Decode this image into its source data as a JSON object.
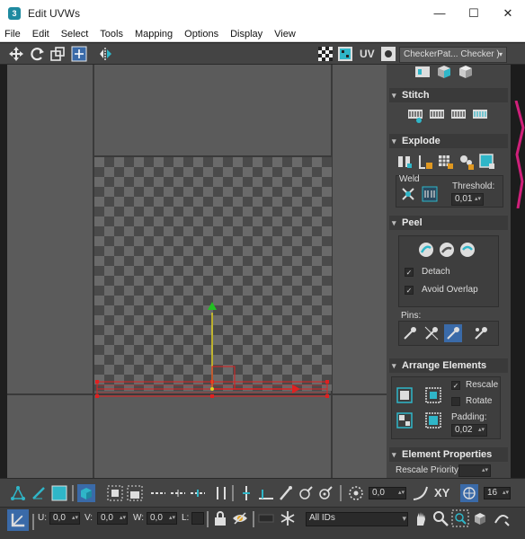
{
  "window": {
    "title": "Edit UVWs",
    "app_icon": "3"
  },
  "menu": [
    "File",
    "Edit",
    "Select",
    "Tools",
    "Mapping",
    "Options",
    "Display",
    "View"
  ],
  "toolbar_top": {
    "uv_label": "UV",
    "texture_dropdown": "CheckerPat... Checker )"
  },
  "panel": {
    "stitch": {
      "title": "Stitch"
    },
    "explode": {
      "title": "Explode",
      "weld_label": "Weld",
      "threshold_label": "Threshold:",
      "threshold_value": "0,01"
    },
    "peel": {
      "title": "Peel",
      "detach_label": "Detach",
      "avoid_overlap_label": "Avoid Overlap",
      "pins_label": "Pins:"
    },
    "arrange": {
      "title": "Arrange Elements",
      "rescale_label": "Rescale",
      "rotate_label": "Rotate",
      "padding_label": "Padding:",
      "padding_value": "0,02"
    },
    "element_props": {
      "title": "Element Properties",
      "rescale_priority_label": "Rescale Priority:"
    }
  },
  "bottom1": {
    "value_field": "0,0",
    "xy_label": "XY",
    "grid_value": "16"
  },
  "bottom2": {
    "u_label": "U:",
    "u_value": "0,0",
    "v_label": "V:",
    "v_value": "0,0",
    "w_label": "W:",
    "w_value": "0,0",
    "l_label": "L:",
    "ids_dropdown": "All IDs"
  },
  "colors": {
    "accent_cyan": "#2fb6c8",
    "gizmo_red": "#e02020",
    "gizmo_green": "#22c022",
    "gizmo_yellow": "#e0d020"
  }
}
